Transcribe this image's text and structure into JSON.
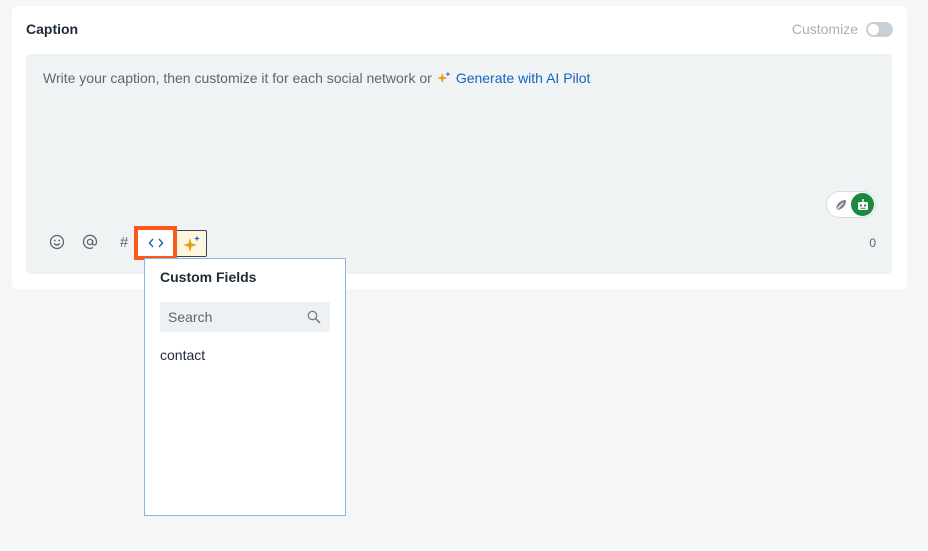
{
  "caption": {
    "title": "Caption",
    "customize_label": "Customize",
    "customize_enabled": false
  },
  "editor": {
    "placeholder": "Write your caption, then customize it for each social network or",
    "ai_link": "Generate with AI Pilot",
    "char_count": "0"
  },
  "toolbar": {
    "emoji_icon": "smile-icon",
    "mention_icon": "at-icon",
    "hashtag_glyph": "#",
    "custom_fields_glyph": "<>",
    "ai_icon": "sparkle-icon"
  },
  "custom_fields": {
    "title": "Custom Fields",
    "search_placeholder": "Search",
    "items": [
      "contact"
    ]
  },
  "colors": {
    "highlight": "#fa5a1e",
    "link": "#1565c0",
    "bot_green": "#1b8a3f",
    "sparkle": "#e2a11a"
  }
}
